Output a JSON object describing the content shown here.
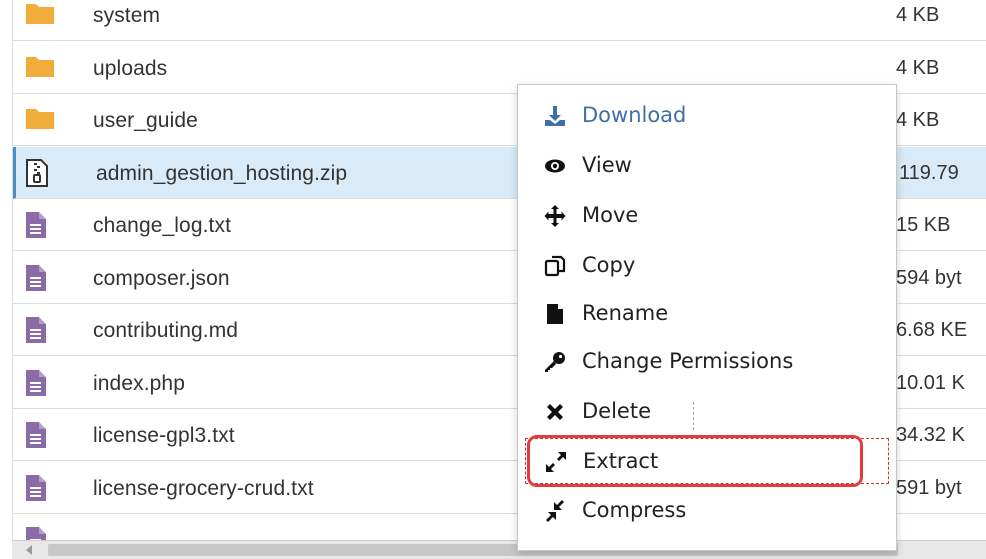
{
  "files": [
    {
      "name": "system",
      "size": "4 KB",
      "type": "folder",
      "selected": false
    },
    {
      "name": "uploads",
      "size": "4 KB",
      "type": "folder",
      "selected": false
    },
    {
      "name": "user_guide",
      "size": "4 KB",
      "type": "folder",
      "selected": false
    },
    {
      "name": "admin_gestion_hosting.zip",
      "size": "119.79",
      "type": "zip",
      "selected": true
    },
    {
      "name": "change_log.txt",
      "size": "15 KB",
      "type": "file",
      "selected": false
    },
    {
      "name": "composer.json",
      "size": "594 byt",
      "type": "file",
      "selected": false
    },
    {
      "name": "contributing.md",
      "size": "6.68 KE",
      "type": "file",
      "selected": false
    },
    {
      "name": "index.php",
      "size": "10.01 K",
      "type": "file",
      "selected": false
    },
    {
      "name": "license-gpl3.txt",
      "size": "34.32 K",
      "type": "file",
      "selected": false
    },
    {
      "name": "license-grocery-crud.txt",
      "size": "591 byt",
      "type": "file",
      "selected": false
    },
    {
      "name": "",
      "size": "",
      "type": "file",
      "selected": false
    }
  ],
  "context_menu": {
    "items": [
      {
        "label": "Download",
        "icon": "download-icon",
        "primary": true
      },
      {
        "label": "View",
        "icon": "eye-icon"
      },
      {
        "label": "Move",
        "icon": "move-icon"
      },
      {
        "label": "Copy",
        "icon": "copy-icon"
      },
      {
        "label": "Rename",
        "icon": "file-icon"
      },
      {
        "label": "Change Permissions",
        "icon": "key-icon"
      },
      {
        "label": "Delete",
        "icon": "close-icon"
      },
      {
        "label": "Extract",
        "icon": "expand-icon",
        "highlighted": true
      },
      {
        "label": "Compress",
        "icon": "compress-icon"
      }
    ]
  },
  "colors": {
    "folder": "#f0ad3c",
    "file": "#8b6aa8",
    "selected_row": "#d9ebf8",
    "primary_link": "#3f6fa5",
    "highlight_border": "#e33c3c"
  }
}
